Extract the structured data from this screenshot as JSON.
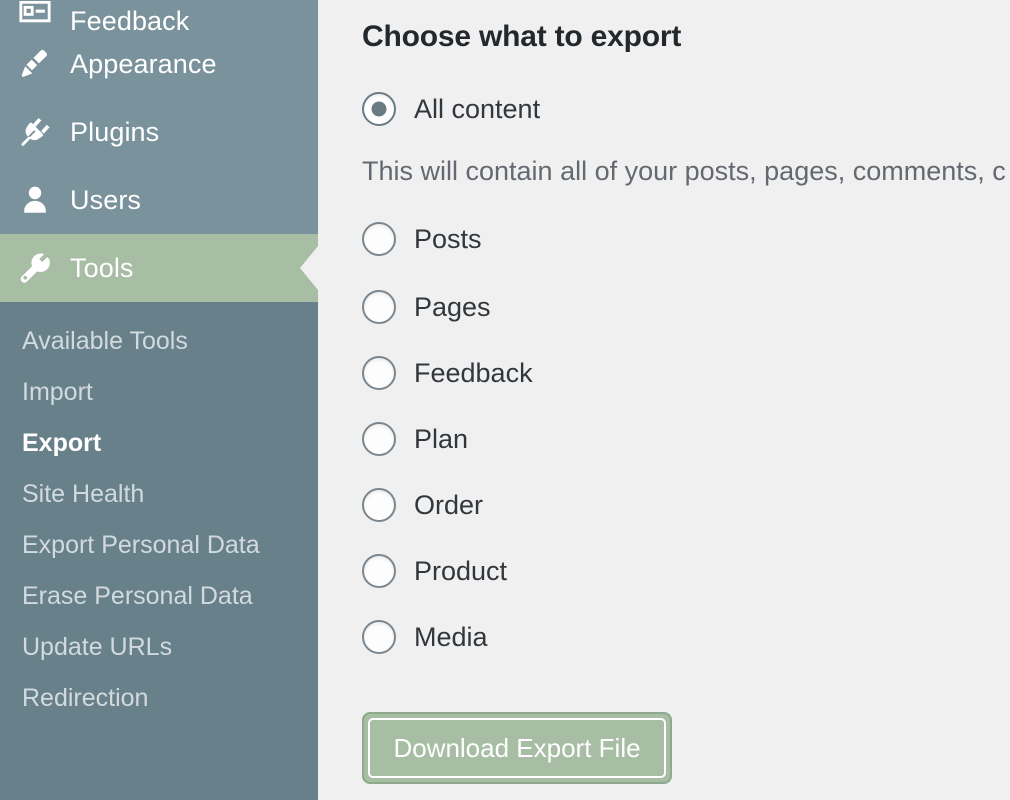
{
  "sidebar": {
    "top_items": [
      {
        "label": "Feedback",
        "icon": "feedback-icon",
        "current": false
      },
      {
        "label": "Appearance",
        "icon": "paintbrush-icon",
        "current": false
      },
      {
        "label": "Plugins",
        "icon": "plug-icon",
        "current": false
      },
      {
        "label": "Users",
        "icon": "user-icon",
        "current": false
      },
      {
        "label": "Tools",
        "icon": "wrench-icon",
        "current": true
      }
    ],
    "submenu_items": [
      {
        "label": "Available Tools",
        "current": false
      },
      {
        "label": "Import",
        "current": false
      },
      {
        "label": "Export",
        "current": true
      },
      {
        "label": "Site Health",
        "current": false
      },
      {
        "label": "Export Personal Data",
        "current": false
      },
      {
        "label": "Erase Personal Data",
        "current": false
      },
      {
        "label": "Update URLs",
        "current": false
      },
      {
        "label": "Redirection",
        "current": false
      }
    ],
    "colors": {
      "background": "#7a929b",
      "submenu_background": "#67808a",
      "current_highlight": "#a7bda4",
      "text": "#ffffff",
      "submenu_text": "#d2dade"
    }
  },
  "main": {
    "heading": "Choose what to export",
    "all_content_description": "This will contain all of your posts, pages, comments, c",
    "options": [
      {
        "label": "All content",
        "checked": true
      },
      {
        "label": "Posts",
        "checked": false
      },
      {
        "label": "Pages",
        "checked": false
      },
      {
        "label": "Feedback",
        "checked": false
      },
      {
        "label": "Plan",
        "checked": false
      },
      {
        "label": "Order",
        "checked": false
      },
      {
        "label": "Product",
        "checked": false
      },
      {
        "label": "Media",
        "checked": false
      }
    ],
    "download_button": {
      "label": "Download Export File",
      "background": "#a7bda4",
      "text_color": "#ffffff",
      "focused": true
    },
    "colors": {
      "background": "#f0f0f1",
      "heading_text": "#23282d",
      "label_text": "#32373c",
      "description_text": "#646970"
    }
  }
}
